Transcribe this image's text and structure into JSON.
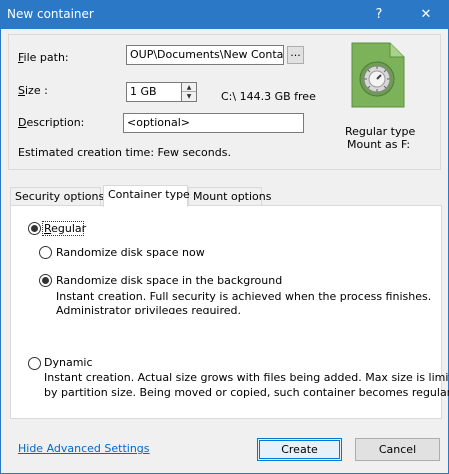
{
  "window": {
    "title": "New container",
    "help_glyph": "?",
    "close_glyph": "✕"
  },
  "form": {
    "file_path_label": "File path:",
    "file_path_value": "OUP\\Documents\\New Container",
    "browse_label": "...",
    "size_label": "Size :",
    "size_value": "1 GB",
    "free_space": "C:\\ 144.3 GB free",
    "description_label": "Description:",
    "description_placeholder": "<optional>",
    "estimated_time": "Estimated creation time:  Few seconds."
  },
  "summary": {
    "type_line": "Regular type",
    "mount_line": "Mount as F:",
    "icon": "safe-lock-icon"
  },
  "tabs": [
    {
      "label": "Security options",
      "active": false
    },
    {
      "label": "Container type",
      "active": true
    },
    {
      "label": "Mount options",
      "active": false
    }
  ],
  "container_type": {
    "regular_label": "Regular",
    "randomize_now_label": "Randomize disk space now",
    "randomize_bg_label": "Randomize disk space in the background",
    "randomize_bg_desc_1": "Instant creation. Full security is achieved when the process finishes.",
    "randomize_bg_desc_2": "Administrator privileges required.",
    "dynamic_label": "Dynamic",
    "dynamic_desc_1": "Instant creation. Actual size grows with files being added. Max size is limited",
    "dynamic_desc_2": "by partition size. Being moved or copied, such container becomes regular.",
    "selected_type": "Regular",
    "selected_randomize": "background"
  },
  "footer": {
    "advanced_link": "Hide Advanced Settings",
    "create_label": "Create",
    "cancel_label": "Cancel"
  },
  "colors": {
    "titlebar": "#2b79c6",
    "link": "#0066cc",
    "safe_green": "#7cb35a"
  }
}
